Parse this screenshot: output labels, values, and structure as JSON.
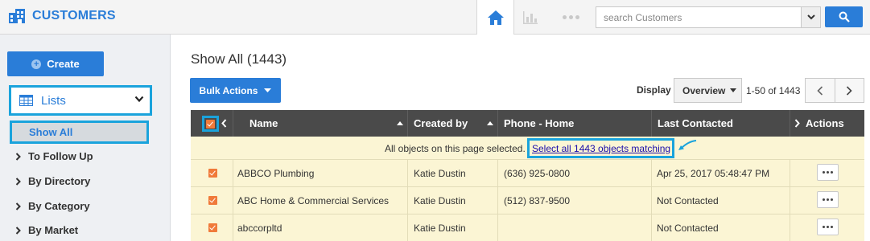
{
  "app": {
    "title": "CUSTOMERS"
  },
  "search": {
    "placeholder": "search Customers"
  },
  "sidebar": {
    "create_label": "Create",
    "lists_label": "Lists",
    "active_item": "Show All",
    "items": [
      "To Follow Up",
      "By Directory",
      "By Category",
      "By Market"
    ]
  },
  "main": {
    "title": "Show All (1443)",
    "bulk_actions_label": "Bulk Actions",
    "display_label": "Display",
    "display_value": "Overview",
    "range_text": "1-50 of 1443"
  },
  "table": {
    "columns": [
      "Name",
      "Created by",
      "Phone - Home",
      "Last Contacted",
      "Actions"
    ],
    "notice_text": "All objects on this page selected.",
    "notice_link": "Select all 1443 objects matching",
    "rows": [
      {
        "name": "ABBCO Plumbing",
        "created_by": "Katie Dustin",
        "phone": "(636) 925-0800",
        "last_contacted": "Apr 25, 2017 05:48:47 PM"
      },
      {
        "name": "ABC Home & Commercial Services",
        "created_by": "Katie Dustin",
        "phone": "(512) 837-9500",
        "last_contacted": "Not Contacted"
      },
      {
        "name": "abccorpltd",
        "created_by": "Katie Dustin",
        "phone": "",
        "last_contacted": "Not Contacted"
      }
    ]
  },
  "colors": {
    "accent": "#2a7dd8",
    "highlight": "#1aa3dc",
    "checkbox": "#f07a3a",
    "row_selected": "#fbf5d4",
    "header": "#4a4a4a"
  }
}
